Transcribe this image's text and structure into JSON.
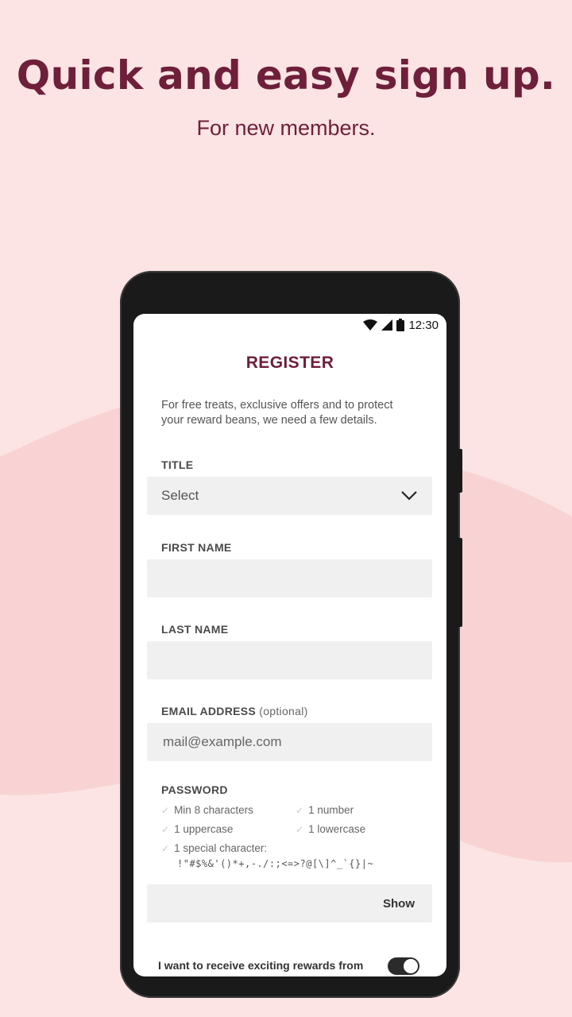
{
  "hero": {
    "title": "Quick and easy sign up.",
    "subtitle": "For new members."
  },
  "status_bar": {
    "time": "12:30",
    "icons": [
      "wifi-icon",
      "signal-icon",
      "battery-icon"
    ]
  },
  "form": {
    "heading": "REGISTER",
    "intro": "For free treats, exclusive offers and to protect your reward beans, we need a few details.",
    "title_label": "TITLE",
    "title_value": "Select",
    "first_name_label": "FIRST NAME",
    "last_name_label": "LAST NAME",
    "email_label": "EMAIL ADDRESS",
    "email_optional": "(optional)",
    "email_placeholder": "mail@example.com",
    "password_label": "PASSWORD",
    "rules": {
      "min_chars": "Min 8 characters",
      "number": "1 number",
      "uppercase": "1 uppercase",
      "lowercase": "1 lowercase",
      "special": "1 special character:",
      "special_chars": "!\"#$%&'()*+,-./:;<=>?@[\\]^_`{}|~"
    },
    "show_label": "Show",
    "consent": "I want to receive exciting rewards from",
    "consent_toggle_on": true
  },
  "colors": {
    "brand": "#6e1f3a",
    "background": "#fce4e4",
    "wave": "#f9d3d4",
    "field_bg": "#f0f0f0"
  }
}
